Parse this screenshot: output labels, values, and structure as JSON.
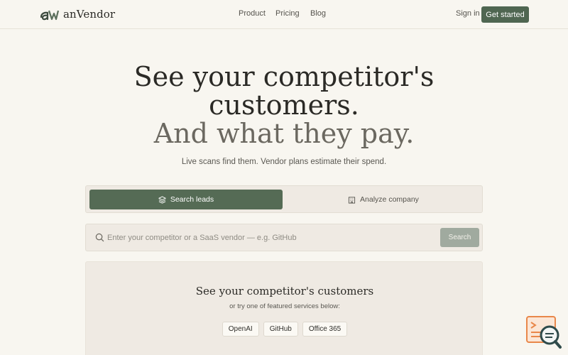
{
  "header": {
    "brand": "anVendor",
    "nav": [
      {
        "label": "Product"
      },
      {
        "label": "Pricing"
      },
      {
        "label": "Blog"
      }
    ],
    "signin_label": "Sign in",
    "cta_label": "Get started"
  },
  "hero": {
    "title_line1": "See your competitor's",
    "title_line2": "customers.",
    "title_line3": "And what they pay.",
    "tagline": "Live scans find them. Vendor plans estimate their spend."
  },
  "modes": {
    "search_leads": "Search leads",
    "analyze_company": "Analyze company"
  },
  "search": {
    "placeholder": "Enter your competitor or a SaaS vendor — e.g. GitHub",
    "button_label": "Search"
  },
  "featured": {
    "title": "See your competitor's customers",
    "subtitle": "or try one of featured services below:",
    "chips": [
      "OpenAI",
      "GitHub",
      "Office 365"
    ]
  },
  "colors": {
    "background": "#f8f6f0",
    "accent": "#4f6651",
    "panel": "#efeae3"
  },
  "icons": {
    "search_leads": "layers-icon",
    "analyze_company": "building-icon",
    "search": "search-icon",
    "widget": "chat-search-icon"
  }
}
